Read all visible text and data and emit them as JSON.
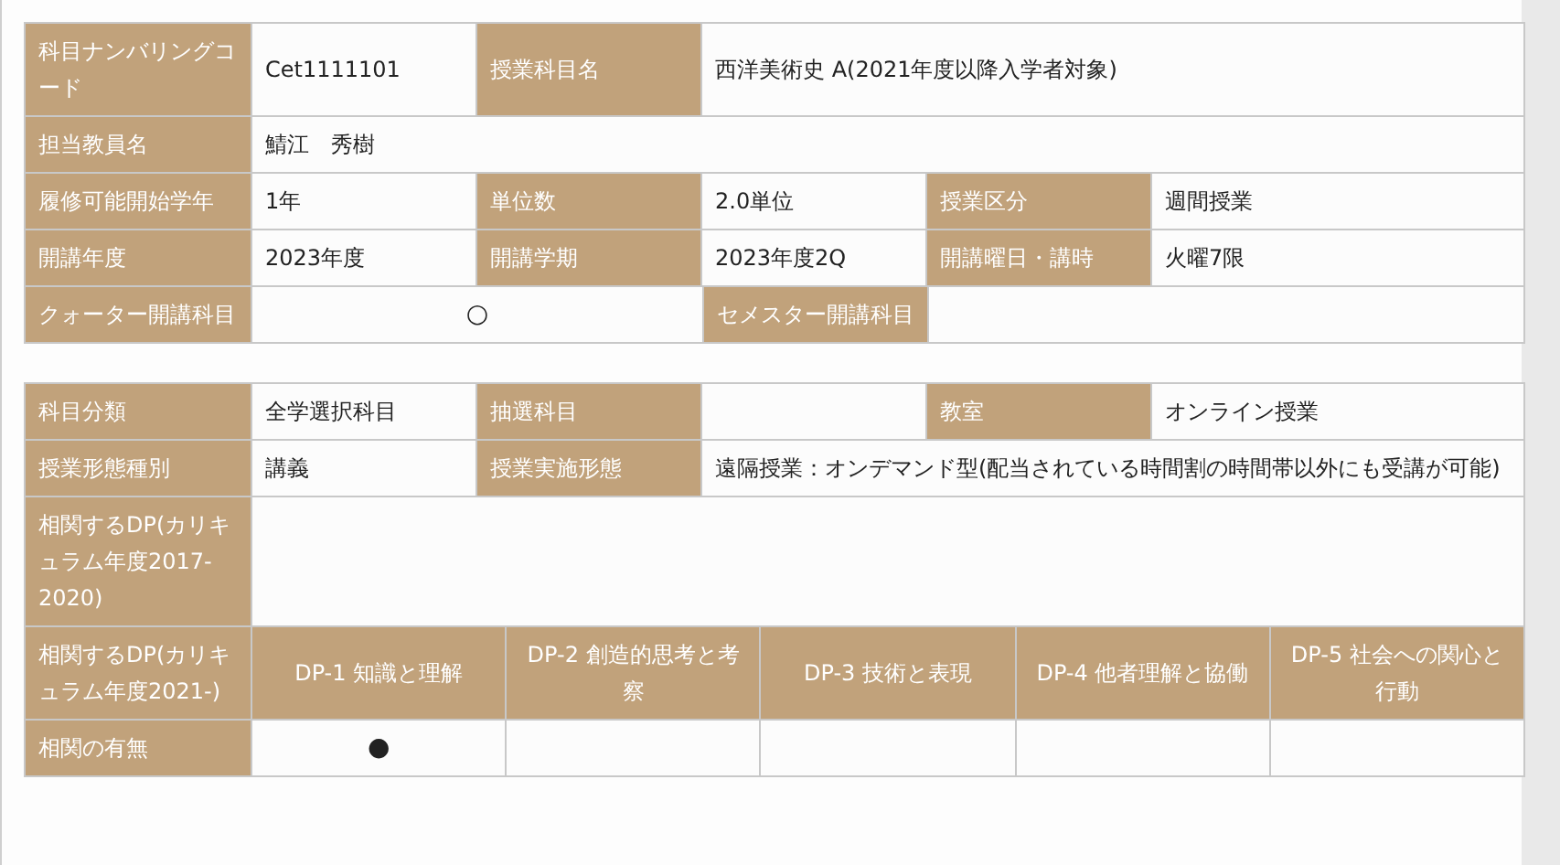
{
  "tables": [
    {
      "rows": [
        {
          "kind": "grid",
          "cells": [
            {
              "kind": "label",
              "text": "科目ナンバリングコード"
            },
            {
              "kind": "value",
              "text": "Cet1111101"
            },
            {
              "kind": "label",
              "text": "授業科目名"
            },
            {
              "kind": "value",
              "colspan": 3,
              "text": "西洋美術史 A(2021年度以降入学者対象)"
            }
          ]
        },
        {
          "kind": "grid",
          "cells": [
            {
              "kind": "label",
              "text": "担当教員名"
            },
            {
              "kind": "value",
              "colspan": 5,
              "text": "鯖江　秀樹"
            }
          ]
        },
        {
          "kind": "grid",
          "cells": [
            {
              "kind": "label",
              "text": "履修可能開始学年"
            },
            {
              "kind": "value",
              "text": "1年"
            },
            {
              "kind": "label",
              "text": "単位数"
            },
            {
              "kind": "value",
              "text": "2.0単位"
            },
            {
              "kind": "label",
              "text": "授業区分"
            },
            {
              "kind": "value",
              "text": "週間授業"
            }
          ]
        },
        {
          "kind": "grid",
          "cells": [
            {
              "kind": "label",
              "text": "開講年度"
            },
            {
              "kind": "value",
              "text": "2023年度"
            },
            {
              "kind": "label",
              "text": "開講学期"
            },
            {
              "kind": "value",
              "text": "2023年度2Q"
            },
            {
              "kind": "label",
              "text": "開講曜日・講時"
            },
            {
              "kind": "value",
              "text": "火曜7限"
            }
          ]
        },
        {
          "kind": "grid",
          "cells": [
            {
              "kind": "label",
              "text": "クォーター開講科目"
            },
            {
              "kind": "mark",
              "colspan": 2,
              "text": "○"
            },
            {
              "kind": "label",
              "text": "セメスター開講科目"
            },
            {
              "kind": "value",
              "colspan": 2
            }
          ]
        }
      ]
    },
    {
      "rows": [
        {
          "kind": "grid",
          "cells": [
            {
              "kind": "label",
              "text": "科目分類"
            },
            {
              "kind": "value",
              "text": "全学選択科目"
            },
            {
              "kind": "label",
              "text": "抽選科目"
            },
            {
              "kind": "value"
            },
            {
              "kind": "label",
              "text": "教室"
            },
            {
              "kind": "value",
              "text": "オンライン授業"
            }
          ]
        },
        {
          "kind": "grid",
          "cells": [
            {
              "kind": "label",
              "text": "授業形態種別"
            },
            {
              "kind": "value",
              "text": "講義"
            },
            {
              "kind": "label",
              "text": "授業実施形態"
            },
            {
              "kind": "value",
              "colspan": 3,
              "text": "遠隔授業：オンデマンド型(配当されている時間割の時間帯以外にも受講が可能)"
            }
          ]
        },
        {
          "kind": "grid",
          "cells": [
            {
              "kind": "label",
              "text": "相関するDP(カリキュラム年度2017-2020)"
            },
            {
              "kind": "value",
              "colspan": 5
            }
          ]
        }
      ]
    },
    {
      "kind": "matrix",
      "rows": [
        {
          "kind": "dp",
          "cells": [
            {
              "kind": "label",
              "text": "相関するDP(カリキュラム年度2021-)"
            },
            {
              "kind": "heading",
              "text": "DP-1 知識と理解"
            },
            {
              "kind": "heading",
              "text": "DP-2 創造的思考と考察"
            },
            {
              "kind": "heading",
              "text": "DP-3 技術と表現"
            },
            {
              "kind": "heading",
              "text": "DP-4 他者理解と協働"
            },
            {
              "kind": "heading",
              "text": "DP-5 社会への関心と行動"
            }
          ]
        },
        {
          "kind": "dp",
          "cells": [
            {
              "kind": "label",
              "text": "相関の有無"
            },
            {
              "kind": "mark",
              "text": "●"
            },
            {
              "kind": "value"
            },
            {
              "kind": "value"
            },
            {
              "kind": "value"
            },
            {
              "kind": "value"
            }
          ]
        }
      ]
    }
  ]
}
